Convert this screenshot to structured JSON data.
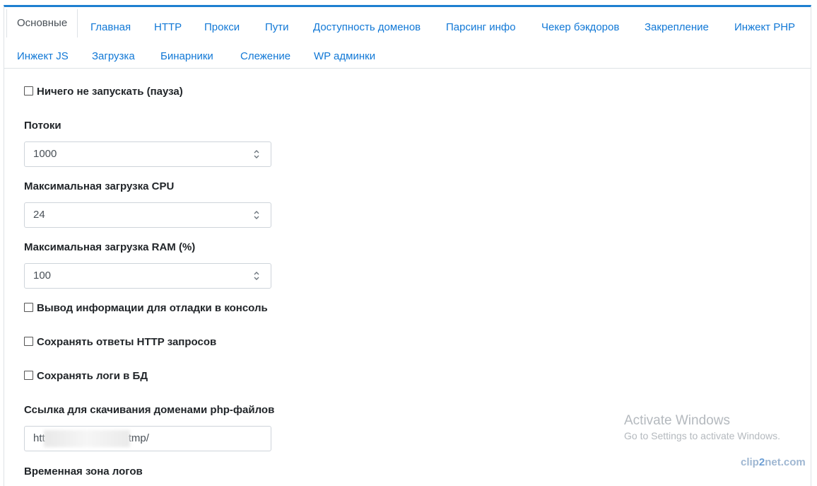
{
  "tabs": [
    {
      "label": "Основные",
      "active": true
    },
    {
      "label": "Главная"
    },
    {
      "label": "HTTP"
    },
    {
      "label": "Прокси"
    },
    {
      "label": "Пути"
    },
    {
      "label": "Доступность доменов"
    },
    {
      "label": "Парсинг инфо"
    },
    {
      "label": "Чекер бэкдоров"
    },
    {
      "label": "Закрепление"
    },
    {
      "label": "Инжект PHP"
    },
    {
      "label": "Инжект JS"
    },
    {
      "label": "Загрузка"
    },
    {
      "label": "Бинарники"
    },
    {
      "label": "Слежение"
    },
    {
      "label": "WP админки"
    }
  ],
  "form": {
    "pause_label": "Ничего не запускать (пауза)",
    "threads_label": "Потоки",
    "threads_value": "1000",
    "cpu_label": "Максимальная загрузка CPU",
    "cpu_value": "24",
    "ram_label": "Максимальная загрузка RAM (%)",
    "ram_value": "100",
    "debug_label": "Вывод информации для отладки в консоль",
    "save_http_label": "Сохранять ответы HTTP запросов",
    "save_logs_label": "Сохранять логи в БД",
    "link_label": "Ссылка для скачивания доменами php-файлов",
    "link_prefix": "htt",
    "link_suffix": "tmp/",
    "timezone_label": "Временная зона логов"
  },
  "watermark": {
    "title": "Activate Windows",
    "subtitle": "Go to Settings to activate Windows."
  },
  "brand": {
    "left": "clip",
    "two": "2",
    "right": "net.com"
  }
}
